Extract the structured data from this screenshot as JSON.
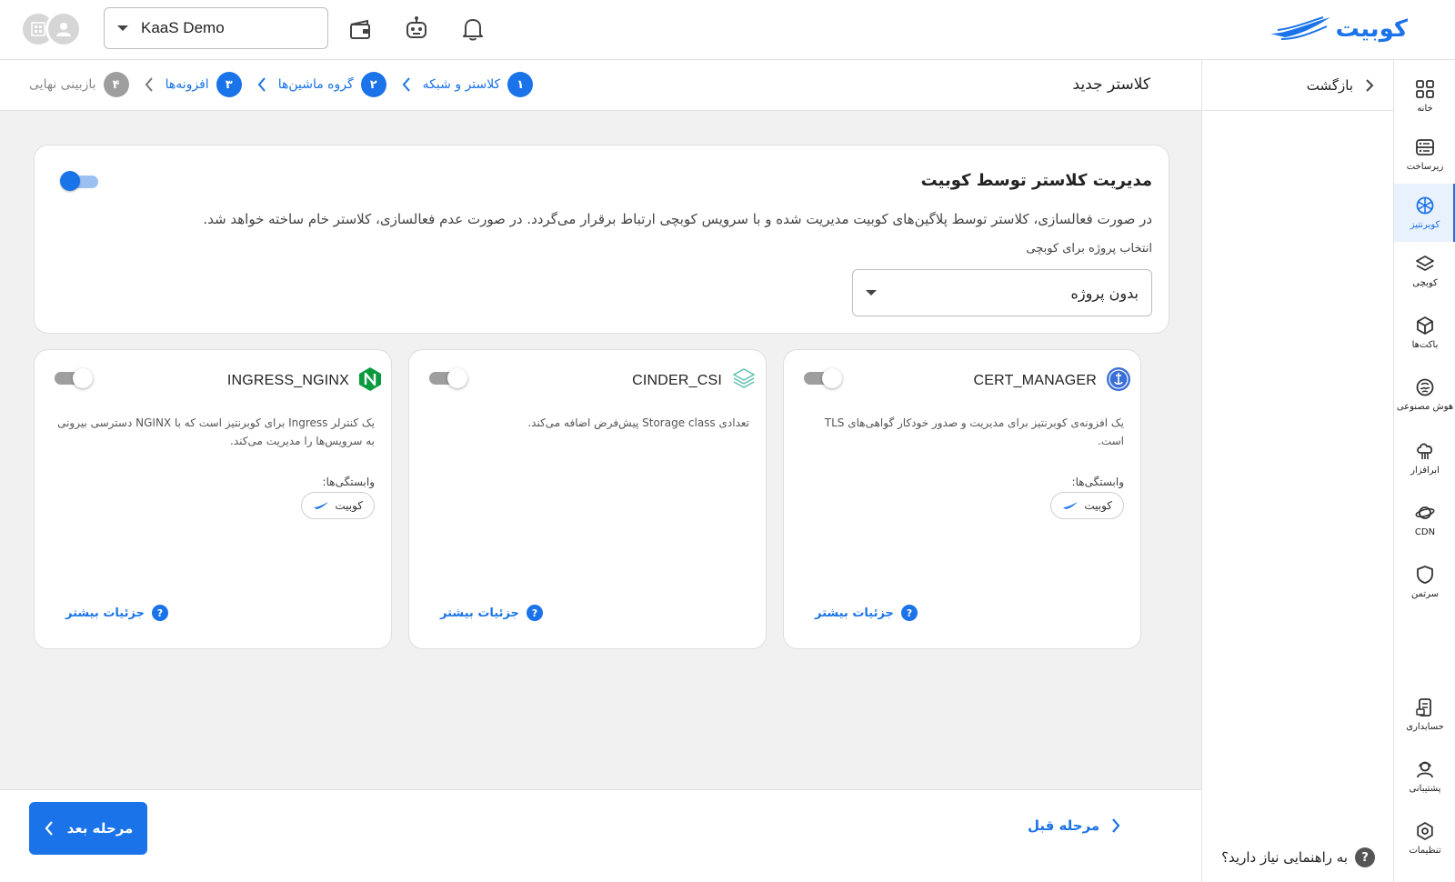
{
  "colors": {
    "accent": "#1a73e8",
    "toggle_off": "#9e9e9e",
    "text": "#222222"
  },
  "brand": {
    "name": "کوبیت",
    "logo_icon": "kubit-wave-logo-icon"
  },
  "topbar": {
    "project_select_value": "KaaS Demo",
    "icons": [
      "wallet-icon",
      "robot-icon",
      "bell-icon"
    ],
    "avatar_icons": [
      "organization-avatar-icon",
      "user-avatar-icon"
    ]
  },
  "sidebar": {
    "items": [
      {
        "label": "خانه",
        "icon": "grid-icon"
      },
      {
        "label": "زیرساخت",
        "icon": "server-icon"
      },
      {
        "label": "کوبرنتیز",
        "icon": "kubernetes-icon"
      },
      {
        "label": "کوبچی",
        "icon": "layers-icon"
      },
      {
        "label": "باکت‌ها",
        "icon": "cube-icon"
      },
      {
        "label": "هوش مصنوعی",
        "icon": "brain-icon"
      },
      {
        "label": "ابرافزار",
        "icon": "cloud-tree-icon"
      },
      {
        "label": "CDN",
        "icon": "planet-icon"
      },
      {
        "label": "سرتمن",
        "icon": "shield-icon"
      },
      {
        "label": "حسابداری",
        "icon": "receipt-icon"
      },
      {
        "label": "پشتیبانی",
        "icon": "support-icon"
      },
      {
        "label": "تنظیمات",
        "icon": "settings-icon"
      }
    ]
  },
  "back_panel": {
    "back_label": "بازگشت",
    "help_text": "به راهنمایی نیاز دارید؟",
    "help_icon": "?"
  },
  "stepbar": {
    "title": "کلاستر جدید",
    "steps": [
      {
        "num": "۱",
        "label": "کلاستر و شبکه",
        "state": "done"
      },
      {
        "num": "۲",
        "label": "گروه ماشین‌ها",
        "state": "done"
      },
      {
        "num": "۳",
        "label": "افزونه‌ها",
        "state": "active"
      },
      {
        "num": "۴",
        "label": "بازبینی نهایی",
        "state": "pending"
      }
    ]
  },
  "managed_card": {
    "title": "مدیریت کلاستر توسط کوبیت",
    "description": "در صورت فعالسازی، کلاستر توسط پلاگین‌های کوبیت مدیریت شده و با سرویس کوبچی ارتباط برقرار می‌گردد. در صورت عدم فعالسازی، کلاستر خام ساخته خواهد شد.",
    "select_label": "انتخاب پروژه برای کوبچی",
    "select_value": "بدون پروژه",
    "toggle_on": true
  },
  "addons": [
    {
      "name": "CERT_MANAGER",
      "icon": "cert-manager-icon",
      "description": "یک افزونه‌ی کوبرنتیز برای مدیریت و صدور خودکار گواهی‌های TLS است.",
      "deps_label": "وابستگی‌ها:",
      "dep": "کوبیت",
      "more": "جزئیات بیشتر",
      "enabled": false
    },
    {
      "name": "CINDER_CSI",
      "icon": "cinder-csi-icon",
      "description": "تعدادی Storage class پیش‌فرض اضافه می‌کند.",
      "deps_label": "",
      "dep": "",
      "more": "جزئیات بیشتر",
      "enabled": false
    },
    {
      "name": "INGRESS_NGINX",
      "icon": "nginx-icon",
      "description": "یک کنترلر Ingress برای کوبرنتیز است که با NGINX دسترسی بیرونی به سرویس‌ها را مدیریت می‌کند.",
      "deps_label": "وابستگی‌ها:",
      "dep": "کوبیت",
      "more": "جزئیات بیشتر",
      "enabled": false
    }
  ],
  "footer": {
    "next_label": "مرحله بعد",
    "prev_label": "مرحله قبل"
  }
}
